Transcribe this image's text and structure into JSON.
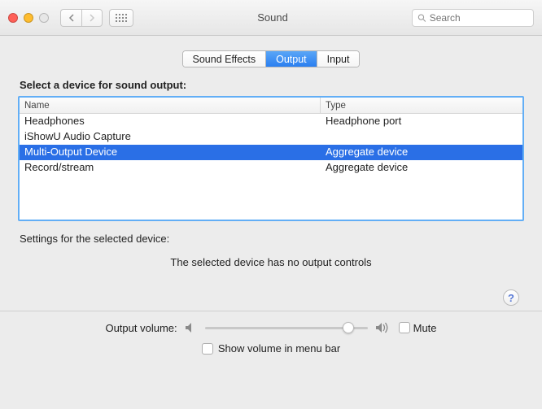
{
  "window": {
    "title": "Sound"
  },
  "search": {
    "placeholder": "Search"
  },
  "tabs": [
    {
      "label": "Sound Effects",
      "active": false
    },
    {
      "label": "Output",
      "active": true
    },
    {
      "label": "Input",
      "active": false
    }
  ],
  "section_label": "Select a device for sound output:",
  "table": {
    "columns": {
      "name": "Name",
      "type": "Type"
    },
    "rows": [
      {
        "name": "Headphones",
        "type": "Headphone port",
        "selected": false
      },
      {
        "name": "iShowU Audio Capture",
        "type": "",
        "selected": false
      },
      {
        "name": "Multi-Output Device",
        "type": "Aggregate device",
        "selected": true
      },
      {
        "name": "Record/stream",
        "type": "Aggregate device",
        "selected": false
      }
    ]
  },
  "settings_label": "Settings for the selected device:",
  "no_controls": "The selected device has no output controls",
  "help": "?",
  "volume": {
    "label": "Output volume:",
    "position_pct": 88,
    "mute_label": "Mute",
    "muted": false
  },
  "show_menu": {
    "label": "Show volume in menu bar",
    "checked": false
  },
  "colors": {
    "selection": "#2a6fe6",
    "tab_active": "#2a7ff0",
    "focus_ring": "#62aef6"
  }
}
